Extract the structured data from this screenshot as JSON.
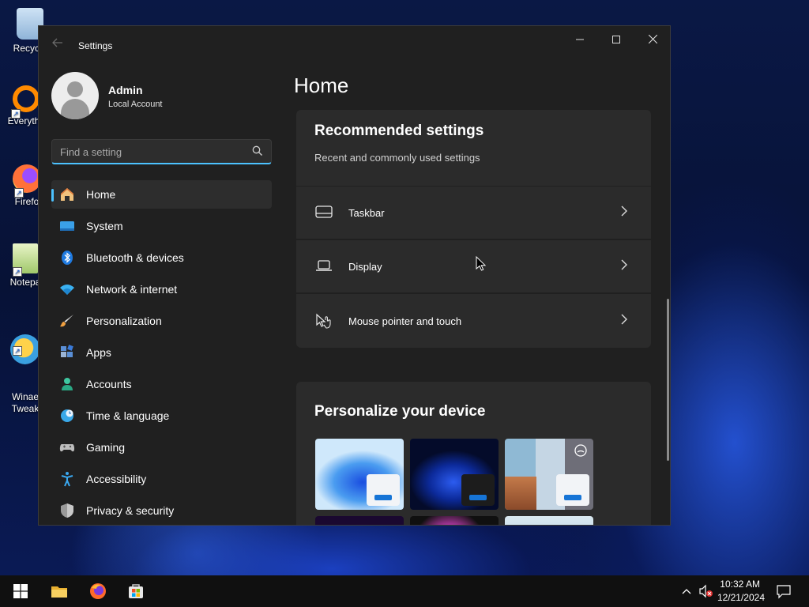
{
  "desktop": {
    "icons": [
      {
        "label": "Recycle"
      },
      {
        "label": "Everyth"
      },
      {
        "label": "Firefo"
      },
      {
        "label": "Notepa"
      },
      {
        "label": "Winae\nTweak"
      }
    ]
  },
  "window": {
    "title": "Settings",
    "back_icon": "back-arrow-icon",
    "minimize_glyph": "—",
    "maximize_glyph": "☐",
    "close_glyph": "✕"
  },
  "user": {
    "name": "Admin",
    "account_type": "Local Account"
  },
  "search": {
    "placeholder": "Find a setting",
    "value": ""
  },
  "nav": {
    "items": [
      {
        "label": "Home",
        "icon": "home-icon",
        "active": true
      },
      {
        "label": "System",
        "icon": "system-icon"
      },
      {
        "label": "Bluetooth & devices",
        "icon": "bluetooth-icon"
      },
      {
        "label": "Network & internet",
        "icon": "wifi-icon"
      },
      {
        "label": "Personalization",
        "icon": "brush-icon"
      },
      {
        "label": "Apps",
        "icon": "apps-icon"
      },
      {
        "label": "Accounts",
        "icon": "accounts-icon"
      },
      {
        "label": "Time & language",
        "icon": "clock-globe-icon"
      },
      {
        "label": "Gaming",
        "icon": "gamepad-icon"
      },
      {
        "label": "Accessibility",
        "icon": "accessibility-icon"
      },
      {
        "label": "Privacy & security",
        "icon": "shield-icon"
      }
    ]
  },
  "content": {
    "page_title": "Home",
    "recommended": {
      "title": "Recommended settings",
      "subtitle": "Recent and commonly used settings",
      "rows": [
        {
          "label": "Taskbar",
          "icon": "taskbar-icon"
        },
        {
          "label": "Display",
          "icon": "laptop-icon"
        },
        {
          "label": "Mouse pointer and touch",
          "icon": "pointer-touch-icon"
        }
      ]
    },
    "personalize": {
      "title": "Personalize your device"
    }
  },
  "taskbar": {
    "time": "10:32 AM",
    "date": "12/21/2024"
  },
  "colors": {
    "accent": "#4cc2ff",
    "window_bg": "#202020",
    "card_bg": "#2b2b2b"
  }
}
